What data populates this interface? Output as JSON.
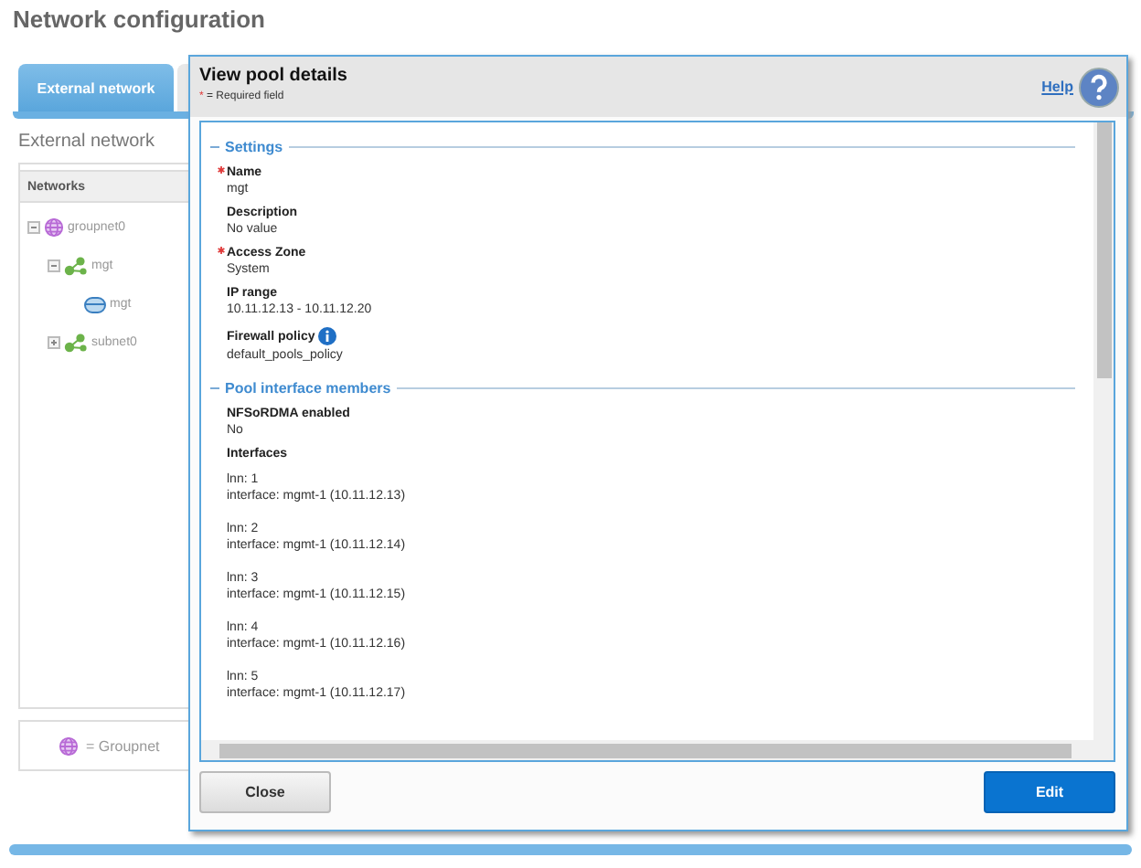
{
  "page_title": "Network configuration",
  "tabs": [
    {
      "label": "External network",
      "selected": true
    }
  ],
  "section_heading": "External network",
  "networks": {
    "header": "Networks",
    "tree": [
      {
        "label": "groupnet0",
        "kind": "groupnet",
        "expanded": true,
        "children": [
          {
            "label": "mgt",
            "kind": "subnet",
            "expanded": true,
            "children": [
              {
                "label": "mgt",
                "kind": "pool"
              }
            ]
          },
          {
            "label": "subnet0",
            "kind": "subnet",
            "expanded": false
          }
        ]
      }
    ]
  },
  "legend": {
    "label": "= Groupnet"
  },
  "dialog": {
    "title": "View pool details",
    "required_mark": "*",
    "required_note": "= Required field",
    "help": "Help",
    "sections": [
      {
        "title": "Settings",
        "fields": [
          {
            "label": "Name",
            "value": "mgt",
            "required": true,
            "info": false
          },
          {
            "label": "Description",
            "value": "No value",
            "required": false,
            "info": false
          },
          {
            "label": "Access Zone",
            "value": "System",
            "required": true,
            "info": false
          },
          {
            "label": "IP range",
            "value": "10.11.12.13 - 10.11.12.20",
            "required": false,
            "info": false
          },
          {
            "label": "Firewall policy",
            "value": "default_pools_policy",
            "required": false,
            "info": true
          }
        ]
      },
      {
        "title": "Pool interface members",
        "fields": [
          {
            "label": "NFSoRDMA enabled",
            "value": "No",
            "required": false,
            "info": false
          }
        ],
        "interfaces_label": "Interfaces",
        "interfaces": [
          {
            "lnn": "lnn: 1",
            "interface": "interface: mgmt-1 (10.11.12.13)"
          },
          {
            "lnn": "lnn: 2",
            "interface": "interface: mgmt-1 (10.11.12.14)"
          },
          {
            "lnn": "lnn: 3",
            "interface": "interface: mgmt-1 (10.11.12.15)"
          },
          {
            "lnn": "lnn: 4",
            "interface": "interface: mgmt-1 (10.11.12.16)"
          },
          {
            "lnn": "lnn: 5",
            "interface": "interface: mgmt-1 (10.11.12.17)"
          }
        ]
      }
    ],
    "buttons": [
      {
        "label": "Close",
        "kind": "secondary"
      },
      {
        "label": "Edit",
        "kind": "primary"
      }
    ]
  }
}
